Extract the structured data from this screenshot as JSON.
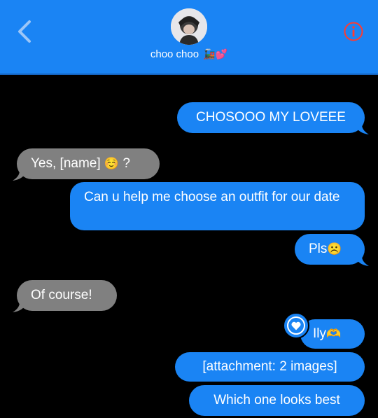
{
  "header": {
    "contact_name": "choo choo",
    "contact_emoji": "🚂💕",
    "back_icon": "chevron-left-icon",
    "info_icon": "info-circle-icon",
    "accent_color": "#1a84f4",
    "info_color": "#ff3b30"
  },
  "messages": [
    {
      "from": "me",
      "text": "CHOSOOO MY LOVEEE"
    },
    {
      "from": "them",
      "text": "Yes, [name]",
      "emoji": "☺️",
      "suffix": " ?"
    },
    {
      "from": "me",
      "text": "Can u help me choose an outfit for our date"
    },
    {
      "from": "me",
      "text": "Pls",
      "emoji": "☹️"
    },
    {
      "from": "them",
      "text": "Of course!"
    },
    {
      "from": "me",
      "text": "Ily",
      "emoji": "🫶",
      "reaction": "heart"
    },
    {
      "from": "me",
      "text": "[attachment: 2 images]"
    },
    {
      "from": "me",
      "text": "Which one looks best"
    }
  ],
  "colors": {
    "sent_bubble": "#1a84f4",
    "received_bubble": "#808080",
    "background": "#000000"
  }
}
